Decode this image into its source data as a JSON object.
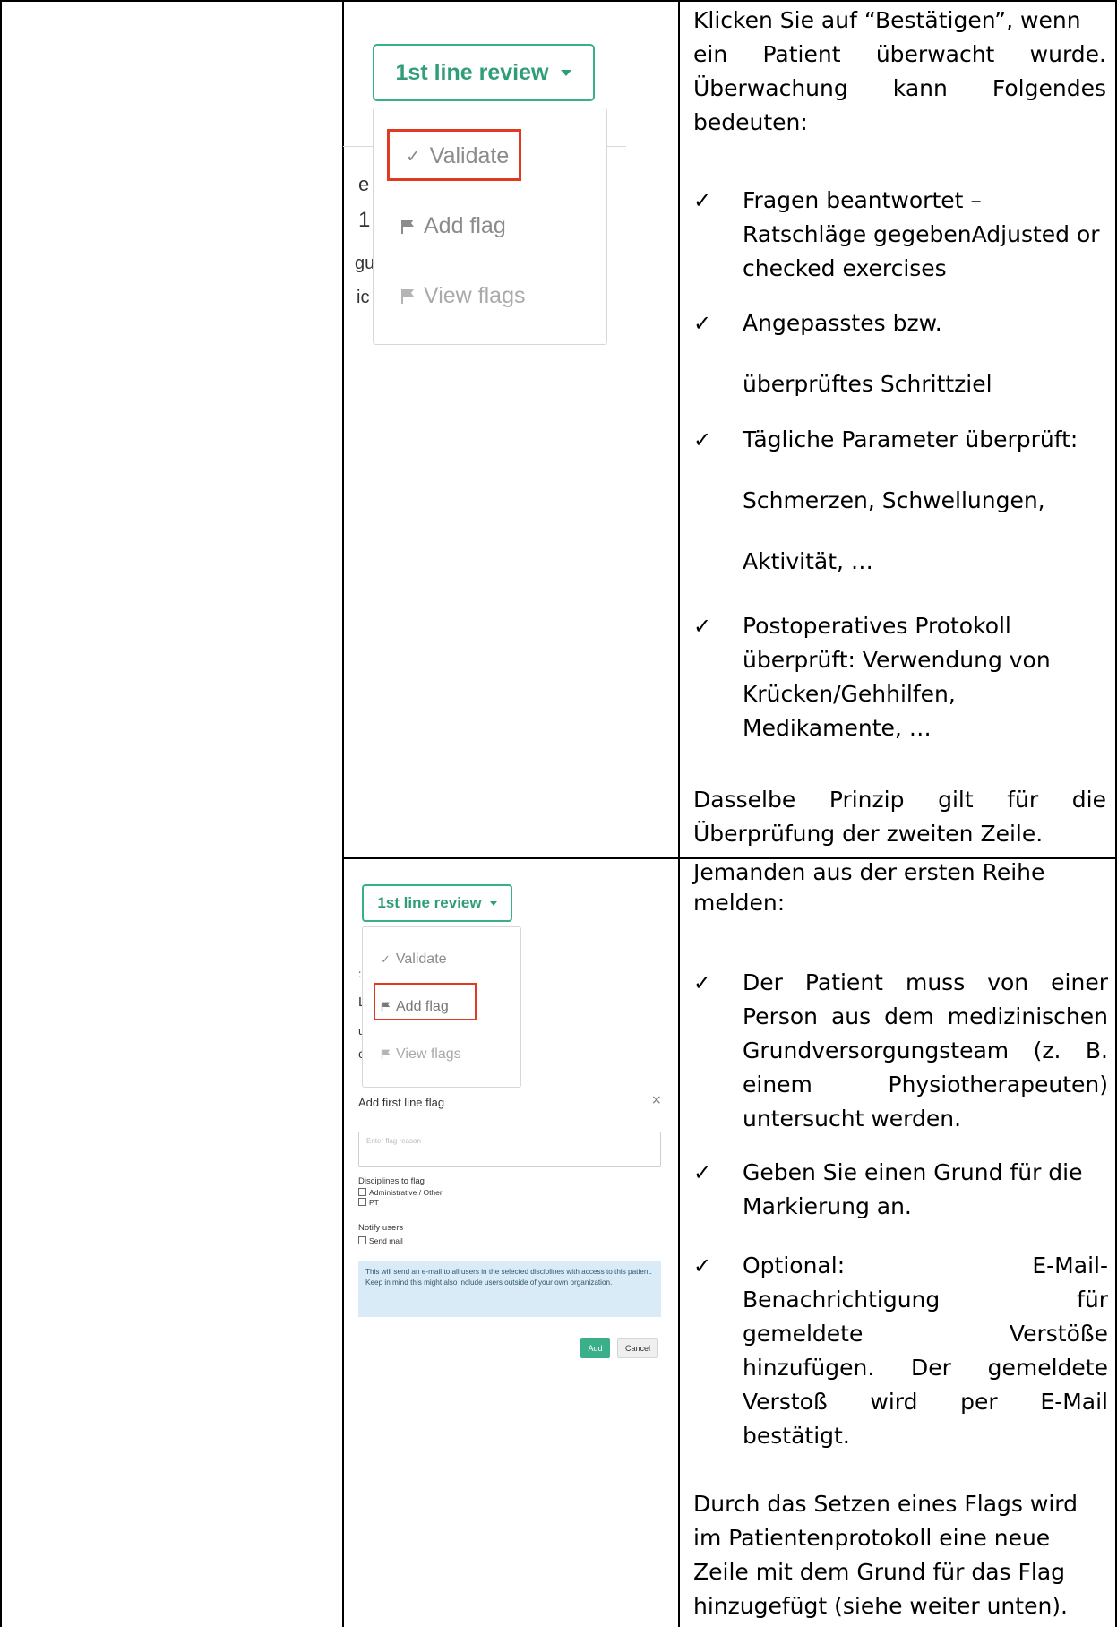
{
  "section1": {
    "screenshot": {
      "button_label": "1st line review",
      "menu": [
        {
          "label": "Validate",
          "icon": "check-icon",
          "highlighted": true
        },
        {
          "label": "Add flag",
          "icon": "flag-icon",
          "highlighted": false
        },
        {
          "label": "View flags",
          "icon": "flag-icon",
          "highlighted": false
        }
      ],
      "bg_fragments": [
        "e",
        "1",
        "gu",
        "ic"
      ],
      "accent_color": "#3ab08a",
      "highlight_color": "#e03a22"
    },
    "intro_lines": [
      "Klicken Sie auf “Bestätigen”, wenn",
      "ein Patient überwacht wurde.",
      "Überwachung kann Folgendes",
      "bedeuten:"
    ],
    "bullets": [
      [
        "Fragen beantwortet –",
        "Ratschläge gegebenAdjusted or",
        "checked exercises"
      ],
      [
        "Angepasstes bzw.",
        "",
        "überprüftes Schrittziel"
      ],
      [
        "Tägliche Parameter überprüft:",
        "",
        "Schmerzen, Schwellungen,",
        "",
        "Aktivität, …"
      ],
      [
        "Postoperatives Protokoll",
        "überprüft: Verwendung von",
        "Krücken/Gehhilfen,",
        "Medikamente, …"
      ]
    ],
    "closing_lines": [
      "Dasselbe Prinzip gilt für die",
      "Überprüfung der zweiten Zeile."
    ],
    "bullet_glyph": "✓"
  },
  "section2": {
    "screenshot": {
      "button_label": "1st line review",
      "menu": [
        {
          "label": "Validate",
          "icon": "check-icon",
          "highlighted": false
        },
        {
          "label": "Add flag",
          "icon": "flag-icon",
          "highlighted": true
        },
        {
          "label": "View flags",
          "icon": "flag-icon",
          "highlighted": false
        }
      ],
      "bg_fragments": [
        ":",
        "L",
        "u",
        "c"
      ],
      "modal": {
        "title": "Add first line flag",
        "close": "×",
        "reason_placeholder": "Enter flag reason",
        "disciplines_label": "Disciplines to flag",
        "disciplines": [
          "Administrative / Other",
          "PT"
        ],
        "notify_label": "Notify users",
        "send_mail": "Send mail",
        "info_text": "This will send an e-mail to all users in the selected disciplines with access to this patient. Keep in mind this might also include users outside of your own organization.",
        "add_button": "Add",
        "cancel_button": "Cancel"
      }
    },
    "intro_lines": [
      "Jemanden aus der ersten Reihe",
      "melden:"
    ],
    "bullets": [
      [
        "Der Patient muss von einer",
        "Person aus dem medizinischen",
        "Grundversorgungsteam (z. B.",
        "einem Physiotherapeuten)",
        "untersucht werden."
      ],
      [
        "Geben Sie einen Grund für die",
        "Markierung an."
      ],
      [
        "Optional: E-Mail-",
        "Benachrichtigung für",
        "gemeldete Verstöße",
        "hinzufügen. Der gemeldete",
        "Verstoß wird per E-Mail",
        "bestätigt."
      ]
    ],
    "closing_lines": [
      "Durch das Setzen eines Flags wird",
      "im Patientenprotokoll eine neue",
      "Zeile mit dem Grund für das Flag",
      "hinzugefügt (siehe weiter unten)."
    ]
  }
}
